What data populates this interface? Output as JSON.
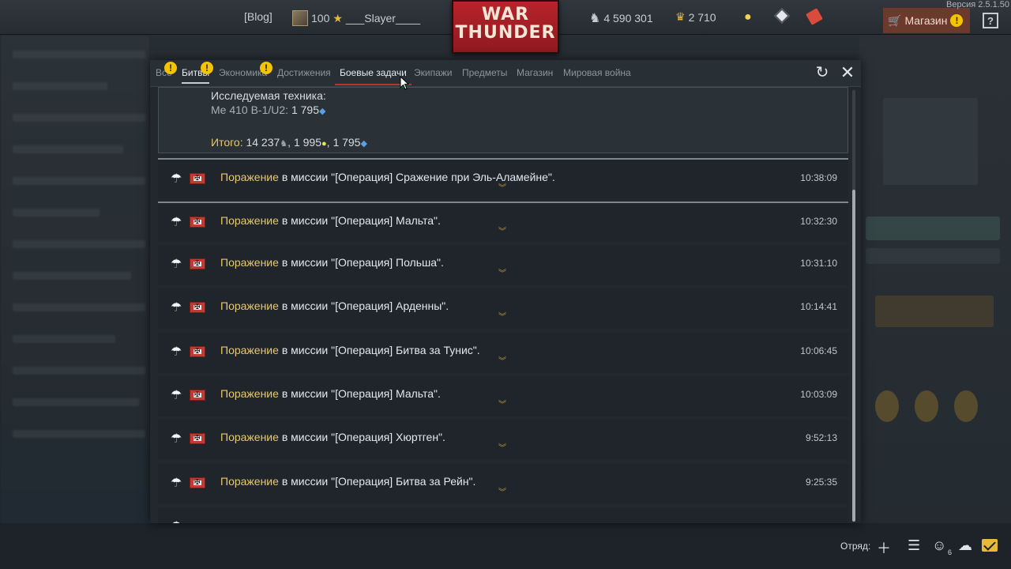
{
  "topbar": {
    "blog": "[Blog]",
    "level": "100",
    "username": "___Slayer____",
    "silver_lions": "4 590 301",
    "golden_eagles": "2 710",
    "shop_label": "Магазин",
    "version": "Версия 2.5.1.50",
    "logo_line1": "WAR",
    "logo_line2": "THUNDER"
  },
  "tabs": [
    "Все",
    "Битвы",
    "Экономика",
    "Достижения",
    "Боевые задачи",
    "Экипажи",
    "Предметы",
    "Магазин",
    "Мировая война"
  ],
  "summary": {
    "line1": "Исследуемая техника:",
    "vehicle_label": "Me 410 B-1/U2:",
    "vehicle_rp": "1 795",
    "total_label": "Итого:",
    "total_sl": "14 237",
    "total_crp": "1 995",
    "total_rp": "1 795"
  },
  "entry_common": {
    "defeat": "Поражение",
    "in_mission": "в миссии"
  },
  "entries": [
    {
      "mission": "\"[Операция] Сражение при Эль-Аламейне\".",
      "time": "10:38:09"
    },
    {
      "mission": "\"[Операция] Мальта\".",
      "time": "10:32:30"
    },
    {
      "mission": "\"[Операция] Польша\".",
      "time": "10:31:10"
    },
    {
      "mission": "\"[Операция] Арденны\".",
      "time": "10:14:41"
    },
    {
      "mission": "\"[Операция] Битва за Тунис\".",
      "time": "10:06:45"
    },
    {
      "mission": "\"[Операция] Мальта\".",
      "time": "10:03:09"
    },
    {
      "mission": "\"[Операция] Хюртген\".",
      "time": "9:52:13"
    },
    {
      "mission": "\"[Операция] Битва за Рейн\".",
      "time": "9:25:35"
    }
  ],
  "bottombar": {
    "squad_label": "Отряд:",
    "friends_count": "6"
  }
}
